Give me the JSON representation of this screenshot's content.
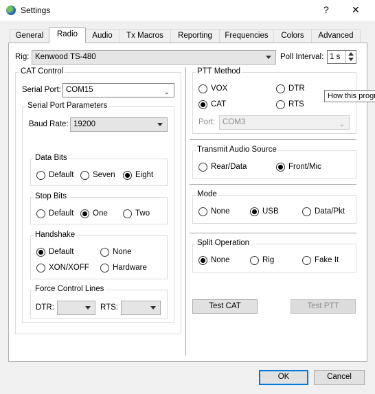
{
  "window": {
    "title": "Settings",
    "help_label": "?",
    "close_label": "✕",
    "icon": "app-globe-icon"
  },
  "tabs": [
    "General",
    "Radio",
    "Audio",
    "Tx Macros",
    "Reporting",
    "Frequencies",
    "Colors",
    "Advanced"
  ],
  "active_tab": "Radio",
  "rig": {
    "label": "Rig:",
    "value": "Kenwood TS-480"
  },
  "poll": {
    "label": "Poll Interval:",
    "value": "1 s"
  },
  "cat": {
    "title": "CAT Control",
    "serial_port_label": "Serial Port:",
    "serial_port_value": "COM15",
    "params_title": "Serial Port Parameters",
    "baud_label": "Baud Rate:",
    "baud_value": "19200",
    "data_bits": {
      "title": "Data Bits",
      "options": [
        "Default",
        "Seven",
        "Eight"
      ],
      "selected": "Eight"
    },
    "stop_bits": {
      "title": "Stop Bits",
      "options": [
        "Default",
        "One",
        "Two"
      ],
      "selected": "One"
    },
    "handshake": {
      "title": "Handshake",
      "options": [
        "Default",
        "None",
        "XON/XOFF",
        "Hardware"
      ],
      "selected": "Default"
    },
    "force": {
      "title": "Force Control Lines",
      "dtr_label": "DTR:",
      "dtr_value": "",
      "rts_label": "RTS:",
      "rts_value": ""
    }
  },
  "ptt": {
    "title": "PTT Method",
    "options": [
      "VOX",
      "DTR",
      "CAT",
      "RTS"
    ],
    "selected": "CAT",
    "port_label": "Port:",
    "port_value": "COM3"
  },
  "tooltip": "How this progr",
  "audio_source": {
    "title": "Transmit Audio Source",
    "options": [
      "Rear/Data",
      "Front/Mic"
    ],
    "selected": "Front/Mic"
  },
  "mode": {
    "title": "Mode",
    "options": [
      "None",
      "USB",
      "Data/Pkt"
    ],
    "selected": "USB"
  },
  "split": {
    "title": "Split Operation",
    "options": [
      "None",
      "Rig",
      "Fake It"
    ],
    "selected": "None"
  },
  "buttons": {
    "test_cat": "Test CAT",
    "test_ptt": "Test PTT",
    "ok": "OK",
    "cancel": "Cancel"
  }
}
